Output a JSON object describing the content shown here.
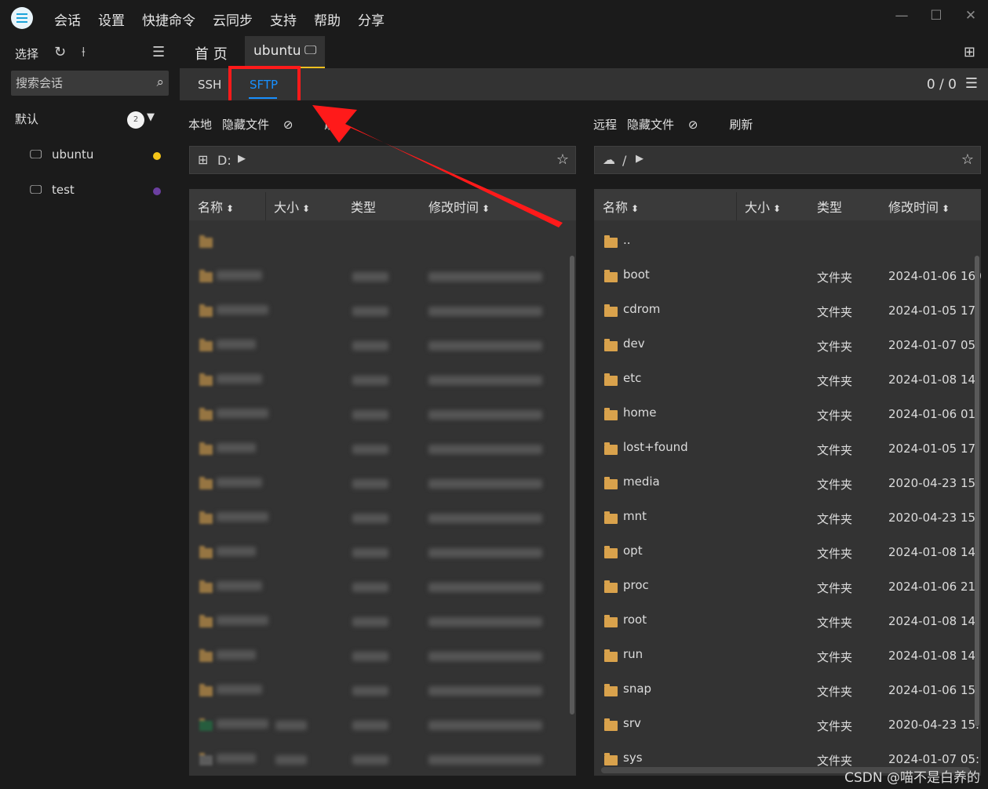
{
  "menu": [
    "会话",
    "设置",
    "快捷命令",
    "云同步",
    "支持",
    "帮助",
    "分享"
  ],
  "window_controls": [
    "—",
    "☐",
    "✕"
  ],
  "sidebar": {
    "select_label": "选择",
    "search_placeholder": "搜索会话",
    "group": {
      "name": "默认",
      "count": "2"
    },
    "hosts": [
      {
        "name": "ubuntu",
        "dot_color": "#f5c518"
      },
      {
        "name": "test",
        "dot_color": "#6b3fa0"
      }
    ]
  },
  "tabs": {
    "home": "首 页",
    "session": "ubuntu"
  },
  "subtabs": {
    "ssh": "SSH",
    "sftp": "SFTP",
    "counter": "0 / 0"
  },
  "local": {
    "title": "本地",
    "hidden_files": "隐藏文件",
    "refresh_partial": "刷",
    "path": "D:",
    "columns": [
      "名称",
      "大小",
      "类型",
      "修改时间"
    ]
  },
  "remote": {
    "title": "远程",
    "hidden_files": "隐藏文件",
    "refresh": "刷新",
    "path": "/",
    "columns": [
      "名称",
      "大小",
      "类型",
      "修改时间"
    ],
    "rows": [
      {
        "name": "..",
        "type": "",
        "mtime": ""
      },
      {
        "name": "boot",
        "type": "文件夹",
        "mtime": "2024-01-06 16:0"
      },
      {
        "name": "cdrom",
        "type": "文件夹",
        "mtime": "2024-01-05 17:"
      },
      {
        "name": "dev",
        "type": "文件夹",
        "mtime": "2024-01-07 05:"
      },
      {
        "name": "etc",
        "type": "文件夹",
        "mtime": "2024-01-08 14:"
      },
      {
        "name": "home",
        "type": "文件夹",
        "mtime": "2024-01-06 01:"
      },
      {
        "name": "lost+found",
        "type": "文件夹",
        "mtime": "2024-01-05 17:"
      },
      {
        "name": "media",
        "type": "文件夹",
        "mtime": "2020-04-23 15:"
      },
      {
        "name": "mnt",
        "type": "文件夹",
        "mtime": "2020-04-23 15:"
      },
      {
        "name": "opt",
        "type": "文件夹",
        "mtime": "2024-01-08 14:"
      },
      {
        "name": "proc",
        "type": "文件夹",
        "mtime": "2024-01-06 21:"
      },
      {
        "name": "root",
        "type": "文件夹",
        "mtime": "2024-01-08 14:"
      },
      {
        "name": "run",
        "type": "文件夹",
        "mtime": "2024-01-08 14:"
      },
      {
        "name": "snap",
        "type": "文件夹",
        "mtime": "2024-01-06 15:"
      },
      {
        "name": "srv",
        "type": "文件夹",
        "mtime": "2020-04-23 15:"
      },
      {
        "name": "sys",
        "type": "文件夹",
        "mtime": "2024-01-07 05:"
      }
    ]
  },
  "watermark": "CSDN @喵不是白养的",
  "colors": {
    "accent": "#1890ff",
    "tab_underline": "#f0c020",
    "annotation": "#ff1a1a",
    "folder": "#d9a24c"
  },
  "icons": {
    "logo": "app-logo",
    "refresh": "refresh-icon",
    "search": "search-icon",
    "monitor": "monitor-icon",
    "star": "star-icon",
    "windows": "windows-icon",
    "cloud": "cloud-icon"
  }
}
